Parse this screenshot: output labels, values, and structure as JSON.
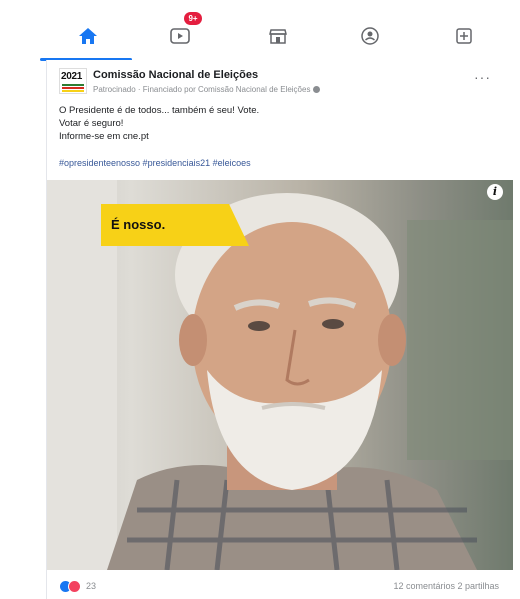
{
  "nav": {
    "tabs": [
      {
        "name": "home",
        "icon": "home-icon",
        "active": true
      },
      {
        "name": "watch",
        "icon": "video-icon",
        "badge": "9+"
      },
      {
        "name": "marketplace",
        "icon": "marketplace-icon"
      },
      {
        "name": "groups",
        "icon": "groups-icon"
      },
      {
        "name": "menu",
        "icon": "menu-icon"
      }
    ],
    "accent": "#1877f2",
    "badge_color": "#e41e3f"
  },
  "post": {
    "page_logo_text": "2021",
    "page_name": "Comissão Nacional de Eleições",
    "sponsored_line": "Patrocinado · Financiado por Comissão Nacional de Eleições",
    "body_lines": [
      "O Presidente é de todos... também é seu! Vote.",
      "Votar é seguro!",
      "Informe-se em cne.pt"
    ],
    "hashtags": "#opresidenteenosso #presidenciais21 #eleicoes",
    "image": {
      "tag_text": "É nosso.",
      "tag_color": "#f7d117",
      "info_label": "i"
    },
    "reaction_count": "23",
    "stats": "12 comentários  2 partilhas"
  }
}
